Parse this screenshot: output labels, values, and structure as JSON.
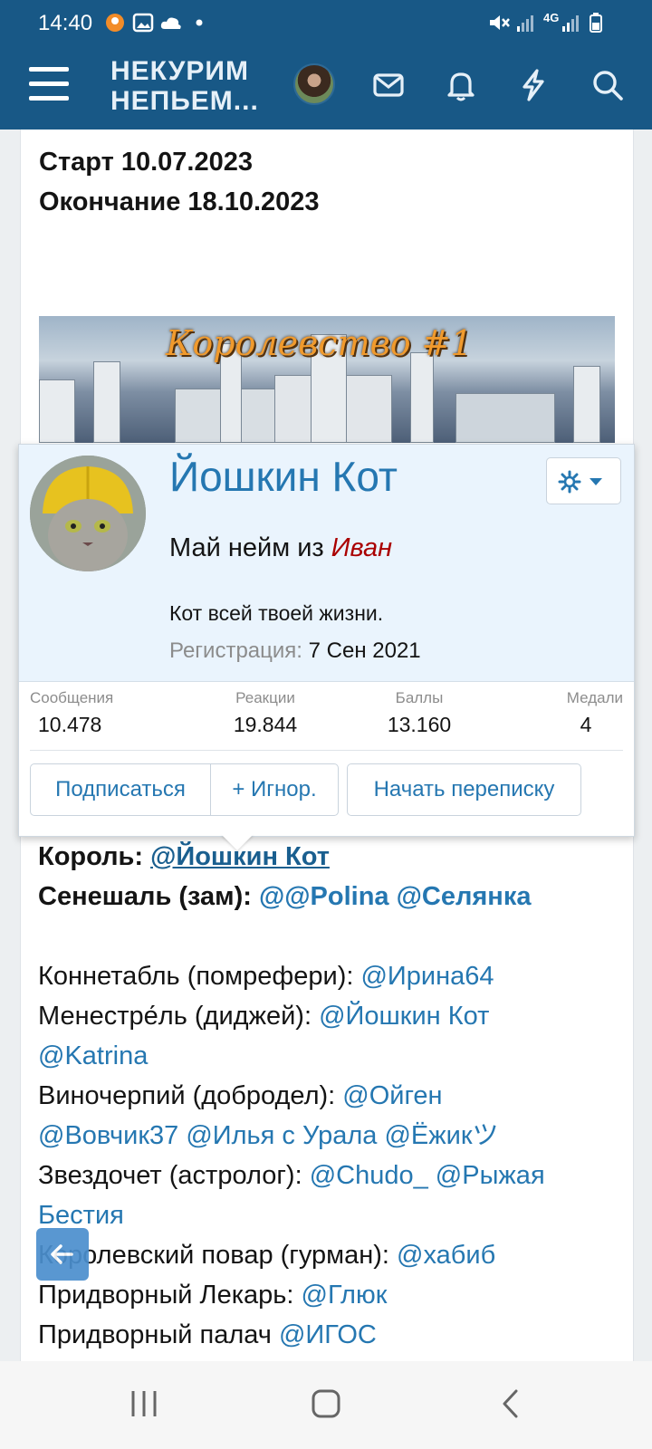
{
  "status_bar": {
    "time": "14:40",
    "network": "4G"
  },
  "header": {
    "site_name": "НЕКУРИМ НЕПЬЕМ..."
  },
  "post": {
    "start": "Старт 10.07.2023",
    "end": "Окончание 18.10.2023",
    "banner_text": "Королевство #1"
  },
  "member_card": {
    "name": "Йошкин Кот",
    "title_prefix": "Май нейм из",
    "title_name": "Иван",
    "status": "Кот всей твоей жизни.",
    "registered_label": "Регистрация:",
    "registered_value": "7 Сен 2021",
    "stats": [
      {
        "label": "Сообщения",
        "value": "10.478"
      },
      {
        "label": "Реакции",
        "value": "19.844"
      },
      {
        "label": "Баллы",
        "value": "13.160"
      },
      {
        "label": "Медали",
        "value": "4"
      }
    ],
    "buttons": {
      "follow": "Подписаться",
      "ignore": "+ Игнор.",
      "message": "Начать переписку"
    }
  },
  "roles": {
    "king_label": "Король:",
    "king": "@Йошкин Кот",
    "seneschal_label": "Сенешаль (зам):",
    "seneschal": "@@Polina @Селянка",
    "constable_label": "Коннетабль (помрефери):",
    "constable": "@Ирина64",
    "minstrel_label": "Менестре́ль (диджей):",
    "minstrel_1": "@Йошкин Кот",
    "minstrel_2": "@Katrina",
    "cupbearer_label": "Виночерпий (добродел):",
    "cupbearer_1": "@Ойген",
    "cupbearer_2": "@Вовчик37 @Илья с Урала @Ёжикツ",
    "astrologer_label": "Звездочет (астролог):",
    "astrologer_1": "@Chudo_ @Рыжая",
    "astrologer_2": "Бестия",
    "cook_label": "Королевский повар (гурман):",
    "cook": "@хабиб",
    "doctor_label": "Придворный Лекарь:",
    "doctor": "@Глюк",
    "executioner_label": "Придворный палач",
    "executioner": "@ИГОС"
  },
  "colors": {
    "header": "#185886",
    "link": "#2577b1",
    "title_red": "#aa0000",
    "card_bg": "#eaf4fd"
  }
}
